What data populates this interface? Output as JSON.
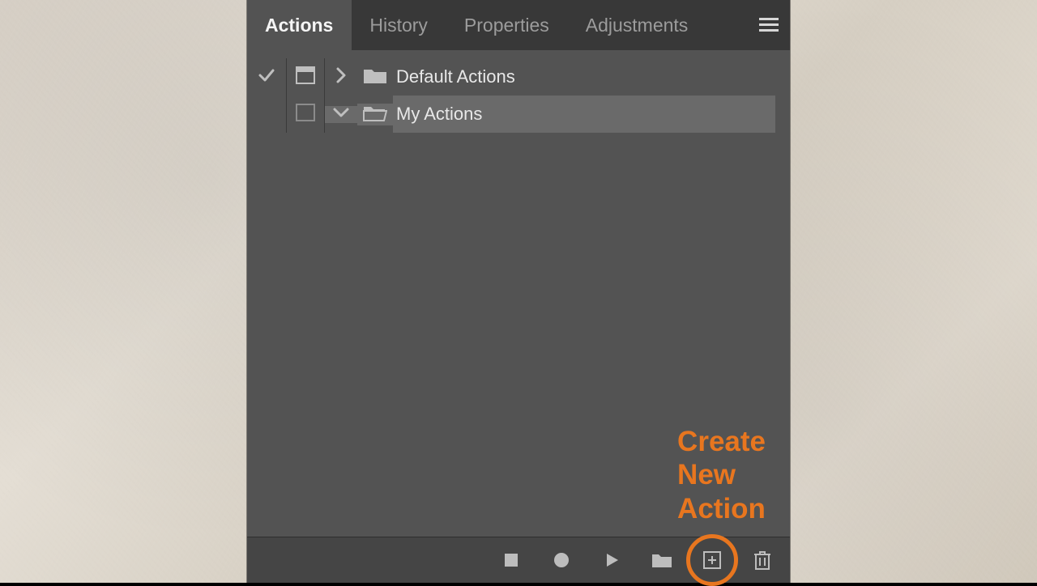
{
  "tabs": {
    "actions": "Actions",
    "history": "History",
    "properties": "Properties",
    "adjustments": "Adjustments"
  },
  "rows": {
    "default_actions": "Default Actions",
    "my_actions": "My Actions"
  },
  "annotation": {
    "line1": "Create",
    "line2": "New",
    "line3": "Action"
  },
  "icons": {
    "menu": "panel-menu-icon",
    "check": "checkmark-icon",
    "dialog": "dialog-toggle-icon",
    "chevron_right": "chevron-right-icon",
    "chevron_down": "chevron-down-icon",
    "folder_closed": "folder-closed-icon",
    "folder_open": "folder-open-icon",
    "stop": "stop-icon",
    "record": "record-icon",
    "play": "play-icon",
    "new_set": "new-set-icon",
    "new_action": "new-action-icon",
    "trash": "trash-icon"
  },
  "colors": {
    "accent": "#e8761f",
    "panel_bg": "#535353",
    "tab_bg": "#383838"
  }
}
